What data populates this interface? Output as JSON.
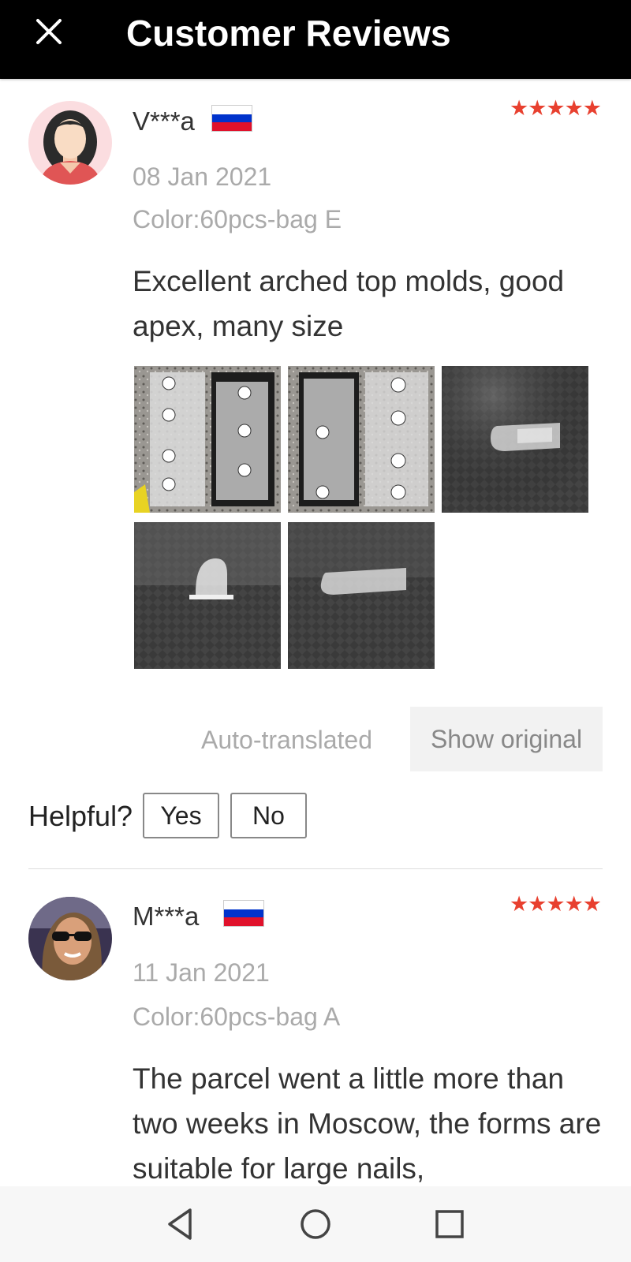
{
  "header": {
    "title": "Customer Reviews",
    "close_icon": "close-icon"
  },
  "reviews": [
    {
      "user": "V***a",
      "country_flag": "russia-flag",
      "rating": 5,
      "stars": "★★★★★",
      "date": "08 Jan 2021",
      "color": "Color:60pcs-bag E",
      "text": "Excellent arched top molds, good apex, many size",
      "photos": [
        "photo-1",
        "photo-2",
        "photo-3",
        "photo-4",
        "photo-5"
      ],
      "auto_translated": "Auto-translated",
      "show_original": "Show original",
      "helpful_label": "Helpful?",
      "yes_label": "Yes",
      "no_label": "No"
    },
    {
      "user": "M***a",
      "country_flag": "russia-flag",
      "rating": 5,
      "stars": "★★★★★",
      "date": "11 Jan 2021",
      "color": "Color:60pcs-bag A",
      "text": "The parcel went a little more than two weeks in Moscow, the forms are suitable for large nails,"
    }
  ],
  "colors": {
    "header_bg": "#000000",
    "star": "#e8402f",
    "muted": "#aaaaaa"
  },
  "navbar": {
    "icons": [
      "back-icon",
      "home-icon",
      "recents-icon"
    ]
  }
}
